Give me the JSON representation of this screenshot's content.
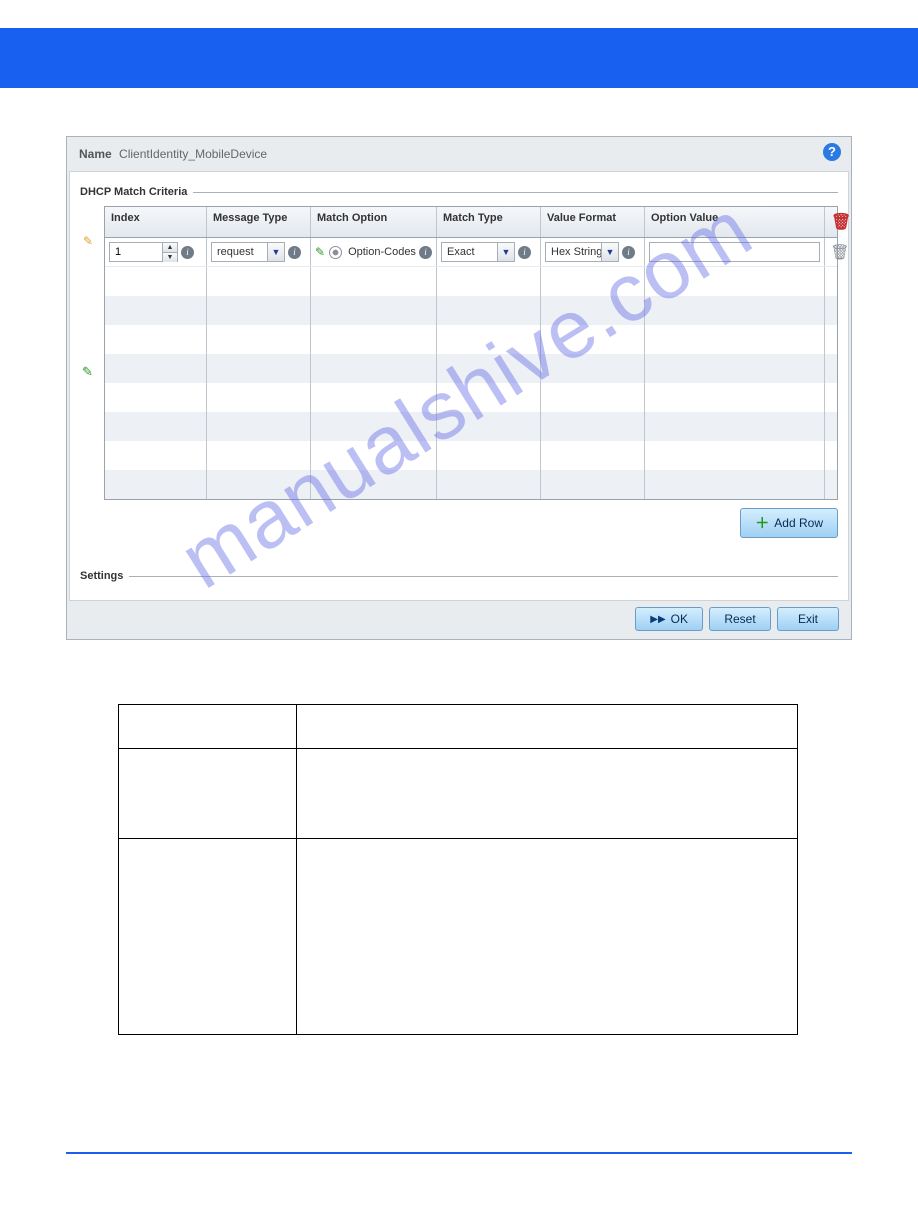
{
  "header": {
    "name_label": "Name",
    "name_value": "ClientIdentity_MobileDevice"
  },
  "dhcp_section": {
    "title": "DHCP Match Criteria",
    "columns": [
      "Index",
      "Message Type",
      "Match Option",
      "Match Type",
      "Value Format",
      "Option Value"
    ],
    "row": {
      "index": "1",
      "message_type": "request",
      "match_option": "Option-Codes",
      "match_type": "Exact",
      "value_format": "Hex String",
      "option_value": ""
    },
    "add_row_label": "Add Row"
  },
  "settings_section": {
    "title": "Settings"
  },
  "footer": {
    "ok_label": "OK",
    "reset_label": "Reset",
    "exit_label": "Exit"
  },
  "watermark_text": "manualshive.com"
}
